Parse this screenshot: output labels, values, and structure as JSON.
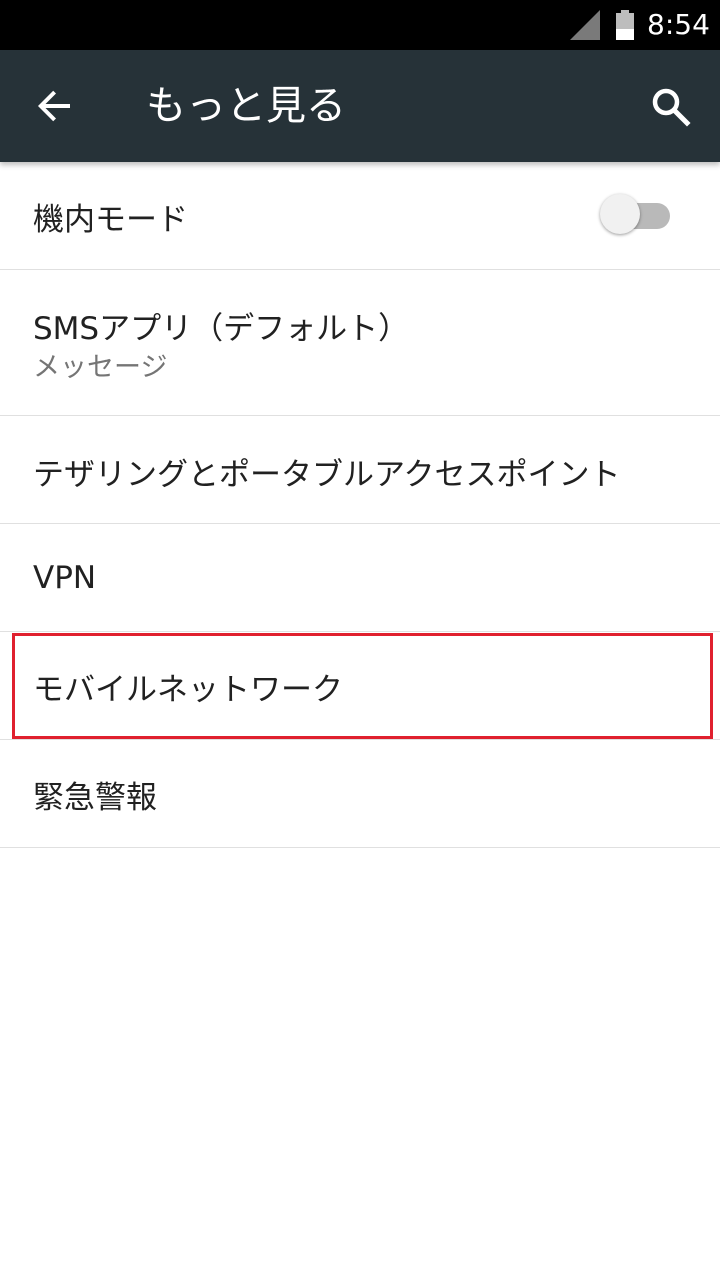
{
  "status_bar": {
    "time": "8:54",
    "signal_icon": "signal-icon",
    "battery_icon": "battery-icon"
  },
  "app_bar": {
    "title": "もっと見る",
    "back_icon": "arrow-back-icon",
    "search_icon": "search-icon"
  },
  "items": [
    {
      "label": "機内モード",
      "toggle": {
        "on": false
      }
    },
    {
      "label": "SMSアプリ（デフォルト）",
      "sub": "メッセージ"
    },
    {
      "label": "テザリングとポータブルアクセスポイント"
    },
    {
      "label": "VPN"
    },
    {
      "label": "モバイルネットワーク",
      "highlighted": true
    },
    {
      "label": "緊急警報"
    }
  ],
  "colors": {
    "app_bar": "#263238",
    "status_bar": "#000000",
    "highlight": "#e0202e",
    "divider": "#e0e0e0"
  }
}
